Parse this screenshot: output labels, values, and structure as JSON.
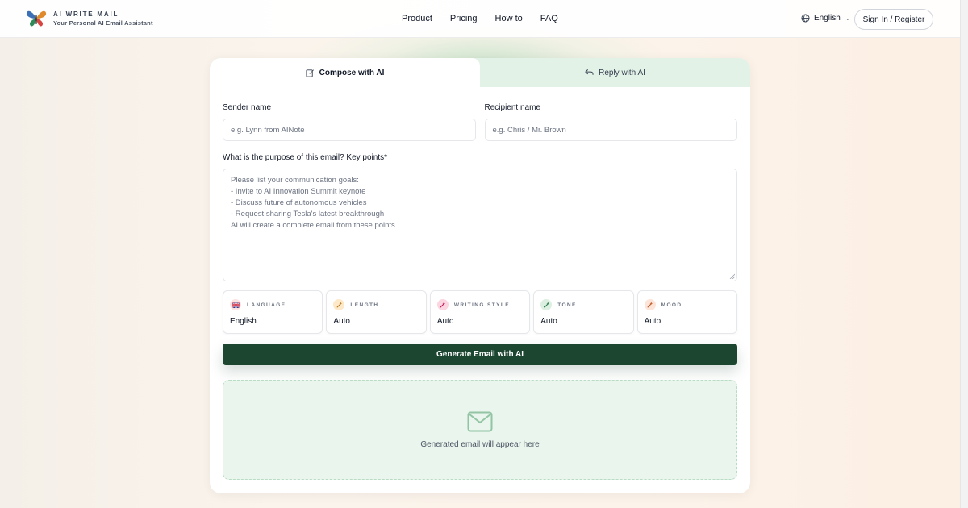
{
  "brand": {
    "title": "AI WRITE MAIL",
    "subtitle": "Your Personal AI Email Assistant",
    "icon": "butterfly-logo"
  },
  "nav": {
    "items": [
      "Product",
      "Pricing",
      "How to",
      "FAQ"
    ]
  },
  "header": {
    "language": "English",
    "signin_label": "Sign In / Register"
  },
  "tabs": {
    "compose": "Compose with AI",
    "reply": "Reply with AI",
    "active": "compose"
  },
  "form": {
    "sender_label": "Sender name",
    "sender_placeholder": "e.g. Lynn from AINote",
    "recipient_label": "Recipient name",
    "recipient_placeholder": "e.g. Chris / Mr. Brown",
    "purpose_label": "What is the purpose of this email? Key points*",
    "purpose_placeholder_lines": [
      "Please list your communication goals:",
      "- Invite to AI Innovation Summit keynote",
      "- Discuss future of autonomous vehicles",
      "- Request sharing Tesla's latest breakthrough",
      "AI will create a complete email from these points"
    ]
  },
  "options": [
    {
      "name": "LANGUAGE",
      "value": "English",
      "icon": "uk-flag-icon",
      "color": "#fde2e2"
    },
    {
      "name": "LENGTH",
      "value": "Auto",
      "icon": "magic-wand-icon",
      "color": "#fde9c8"
    },
    {
      "name": "WRITING STYLE",
      "value": "Auto",
      "icon": "magic-wand-icon",
      "color": "#fbd5e0"
    },
    {
      "name": "TONE",
      "value": "Auto",
      "icon": "magic-wand-icon",
      "color": "#dcefe1"
    },
    {
      "name": "MOOD",
      "value": "Auto",
      "icon": "magic-wand-icon",
      "color": "#fde4d8"
    }
  ],
  "generate_label": "Generate Email with AI",
  "result": {
    "placeholder": "Generated email will appear here",
    "icon": "mail-icon"
  },
  "colors": {
    "primary": "#1c4630",
    "tab_inactive_bg": "#e3f2e7",
    "result_bg": "#eaf5ed"
  }
}
